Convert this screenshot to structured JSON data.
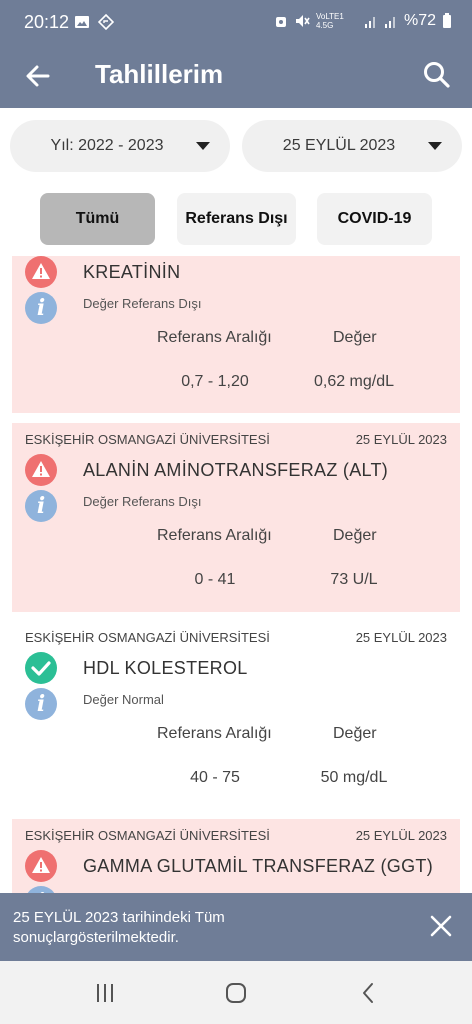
{
  "status_bar": {
    "time": "20:12",
    "network": "VoLTE1 4.5G",
    "battery": "%72"
  },
  "app_bar": {
    "title": "Tahlillerim"
  },
  "filters": {
    "year": "Yıl: 2022 - 2023",
    "date": "25 EYLÜL 2023"
  },
  "tabs": [
    {
      "label": "Tümü"
    },
    {
      "label": "Referans Dışı"
    },
    {
      "label": "COVID-19"
    }
  ],
  "results_labels": {
    "ref_header": "Referans Aralığı",
    "value_header": "Değer"
  },
  "results": [
    {
      "institution": "",
      "date": "",
      "test": "KREATİNİN",
      "status_text": "Değer Referans Dışı",
      "status": "abnormal",
      "range": "0,7 - 1,20",
      "value": "0,62 mg/dL"
    },
    {
      "institution": "ESKİŞEHİR OSMANGAZİ ÜNİVERSİTESİ",
      "date": "25 EYLÜL 2023",
      "test": "ALANİN AMİNOTRANSFERAZ (ALT)",
      "status_text": "Değer Referans Dışı",
      "status": "abnormal",
      "range": "0 - 41",
      "value": "73 U/L"
    },
    {
      "institution": "ESKİŞEHİR OSMANGAZİ ÜNİVERSİTESİ",
      "date": "25 EYLÜL 2023",
      "test": "HDL KOLESTEROL",
      "status_text": "Değer Normal",
      "status": "normal",
      "range": "40 - 75",
      "value": "50 mg/dL"
    },
    {
      "institution": "ESKİŞEHİR OSMANGAZİ ÜNİVERSİTESİ",
      "date": "25 EYLÜL 2023",
      "test": "GAMMA GLUTAMİL TRANSFERAZ (GGT)",
      "status_text": "",
      "status": "abnormal",
      "range": "",
      "value": ""
    }
  ],
  "snackbar": {
    "message": "25 EYLÜL 2023 tarihindeki Tüm sonuçlargösterilmektedir."
  },
  "colors": {
    "header": "#6f7d97",
    "abnormal_bg": "#fde4e3",
    "warning": "#ef7070",
    "normal": "#2bbf95",
    "info": "#8fb3dc",
    "active_tab": "#b7b7b7"
  }
}
